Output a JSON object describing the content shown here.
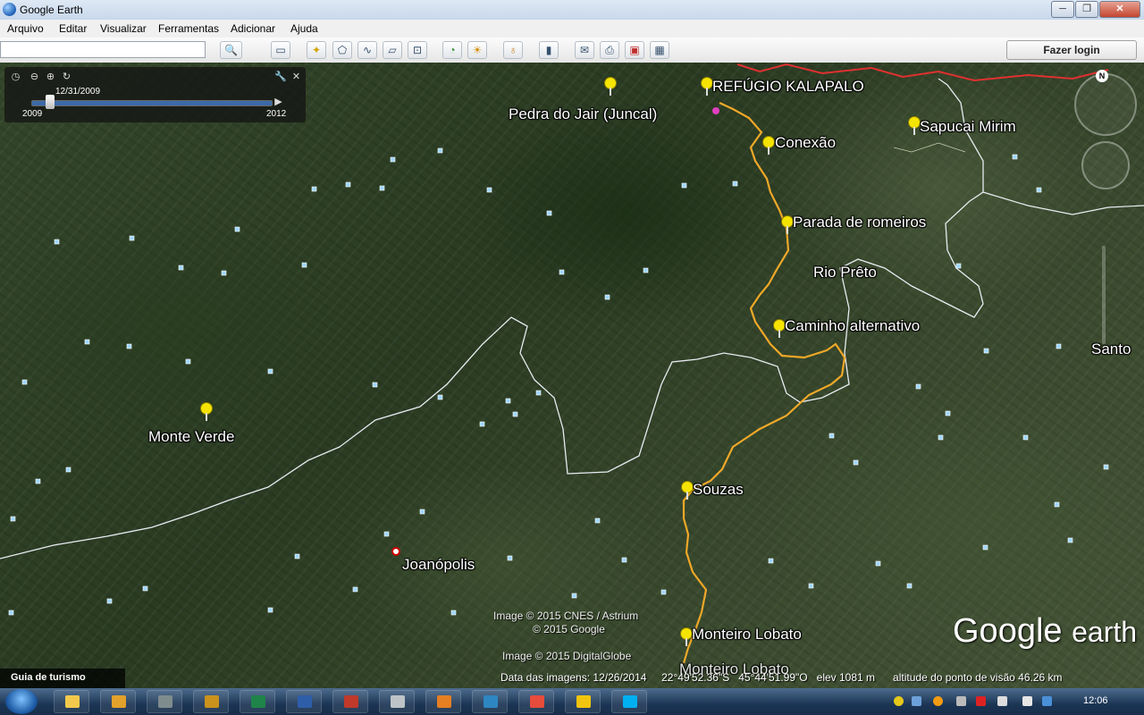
{
  "window": {
    "title": "Google Earth",
    "controls": [
      "minimize",
      "maximize",
      "close"
    ],
    "control_glyphs": [
      "─",
      "❐",
      "✕"
    ]
  },
  "menu": {
    "items": [
      "Arquivo",
      "Editar",
      "Visualizar",
      "Ferramentas",
      "Adicionar",
      "Ajuda"
    ]
  },
  "toolbar": {
    "search_value": "",
    "login_label": "Fazer login",
    "buttons": [
      "search-icon",
      "sidebar-icon",
      "placemark-icon",
      "polygon-icon",
      "path-icon",
      "overlay-icon",
      "tour-icon",
      "historical-imagery-icon",
      "sunlight-icon",
      "planets-icon",
      "ruler-icon",
      "email-icon",
      "print-icon",
      "maps-icon",
      "save-image-icon"
    ]
  },
  "time_slider": {
    "current_date": "12/31/2009",
    "start_year": "2009",
    "end_year": "2012",
    "position": 0.08
  },
  "placemarks": [
    {
      "name": "REFÚGIO KALAPALO"
    },
    {
      "name": "Pedra do Jair (Juncal)"
    },
    {
      "name": "Conexão"
    },
    {
      "name": "Sapucai Mirim"
    },
    {
      "name": "Parada de romeiros"
    },
    {
      "name": "Caminho alternativo"
    },
    {
      "name": "Monte Verde"
    },
    {
      "name": "Souzas"
    },
    {
      "name": "Monteiro Lobato"
    }
  ],
  "map_labels": {
    "rio_preto": "Rio Prêto",
    "santo": "Santo",
    "joanopolis": "Joanópolis",
    "monteiro_lobato_town": "Monteiro Lobato"
  },
  "attribution": {
    "line1": "Image © 2015 CNES / Astrium",
    "line2": "© 2015 Google",
    "line3": "Image © 2015 DigitalGlobe",
    "logo_word1": "Google",
    "logo_word2": "earth"
  },
  "status_bar": {
    "imagery_date": "Data das imagens: 12/26/2014",
    "latitude": "22°49'52.36\"S",
    "longitude": "45°44'51.99\"O",
    "elevation": "elev  1081 m",
    "eye_altitude": "altitude do ponto de visão  46.26 km"
  },
  "tour_guide": {
    "label": "Guia de turismo"
  },
  "compass": {
    "north": "N"
  },
  "taskbar": {
    "time": "12:06",
    "apps": [
      "explorer",
      "media-player",
      "calculator",
      "app-orange",
      "excel",
      "word",
      "acrobat",
      "notes",
      "paint",
      "internet-explorer",
      "chrome",
      "windows-explorer",
      "skype"
    ]
  },
  "colors": {
    "route": "#f0a828",
    "boundary_white": "#e8ecf2",
    "boundary_red": "#e03030",
    "pin": "#f5e400"
  }
}
